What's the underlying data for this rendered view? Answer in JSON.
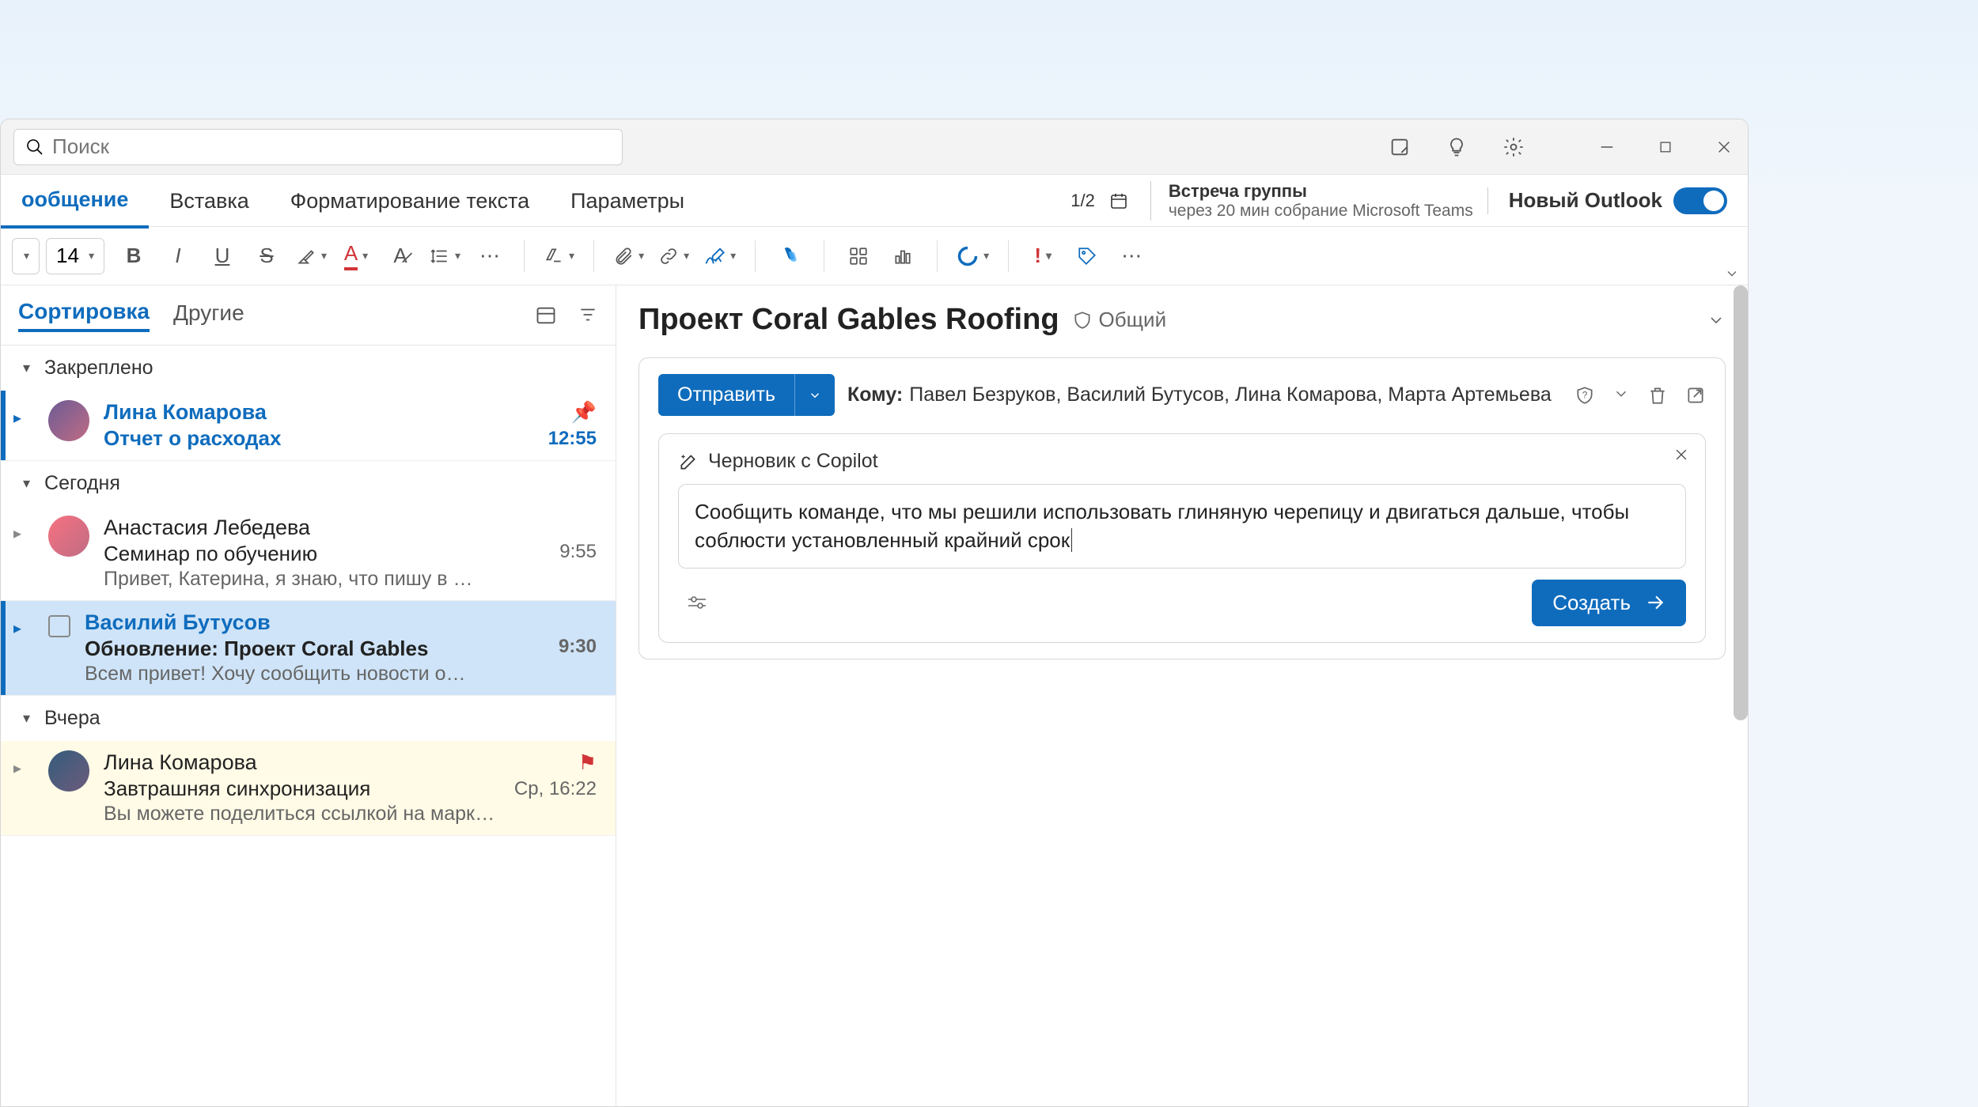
{
  "titlebar": {
    "search_placeholder": "Поиск"
  },
  "ribbon": {
    "tabs": [
      "ообщение",
      "Вставка",
      "Форматирование текста",
      "Параметры"
    ],
    "counter": "1/2",
    "meeting": {
      "title": "Встреча группы",
      "detail": "через 20 мин собрание Microsoft Teams"
    },
    "new_outlook": "Новый Outlook",
    "font_size": "14"
  },
  "mailList": {
    "tab_sort": "Сортировка",
    "tab_other": "Другие",
    "sections": {
      "pinned": "Закреплено",
      "today": "Сегодня",
      "yesterday": "Вчера"
    },
    "items": [
      {
        "from": "Лина Комарова",
        "subject": "Отчет о расходах",
        "time": "12:55"
      },
      {
        "from": "Анастасия Лебедева",
        "subject": "Семинар по обучению",
        "preview": "Привет, Катерина, я знаю, что пишу в …",
        "time": "9:55"
      },
      {
        "from": "Василий Бутусов",
        "subject": "Обновление: Проект Coral Gables",
        "preview": "Всем привет! Хочу сообщить новости о…",
        "time": "9:30"
      },
      {
        "from": "Лина Комарова",
        "subject": "Завтрашняя синхронизация",
        "preview": "Вы можете поделиться ссылкой на марке…",
        "time": "Ср, 16:22"
      }
    ]
  },
  "reading": {
    "title": "Проект Coral Gables Roofing",
    "badge": "Общий",
    "send": "Отправить",
    "to_label": "Кому:",
    "to_value": "Павел Безруков, Василий Бутусов, Лина Комарова, Марта Артемьева",
    "copilot_title": "Черновик с Copilot",
    "copilot_text": "Сообщить команде, что мы решили использовать глиняную черепицу и двигаться дальше, чтобы соблюсти установленный крайний срок",
    "create": "Создать"
  }
}
